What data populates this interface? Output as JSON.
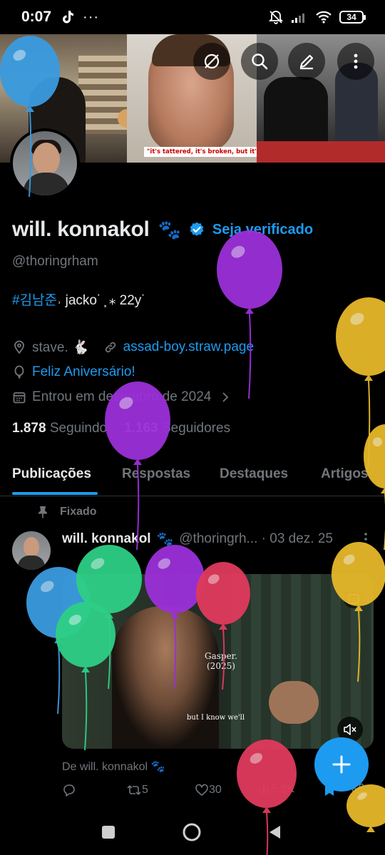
{
  "status_bar": {
    "time": "0:07",
    "battery": "34"
  },
  "header_actions": [
    "grok-icon",
    "search-icon",
    "edit-icon",
    "more-icon"
  ],
  "banner": {
    "caption": "\"it's tattered, it's broken, but it's mine.\""
  },
  "profile": {
    "name": "will. konnakol",
    "name_emoji": "🐾",
    "get_verified": "Seja verificado",
    "handle": "@thoringrham",
    "bio_tag": "#김남준",
    "bio_rest": "˒ jacko˙ ͙ ⁎ 22y˙",
    "location": "stave. 🐇",
    "website": "assad-boy.straw.page",
    "birthday": "Feliz Aniversário!",
    "joined": "Entrou em dezembro de 2024",
    "following_count": "1.878",
    "following_label": "Seguindo",
    "followers_count": "1.163",
    "followers_label": "Seguidores"
  },
  "tabs": [
    "Publicações",
    "Respostas",
    "Destaques",
    "Artigos"
  ],
  "post": {
    "pinned_label": "Fixado",
    "author": "will. konnakol",
    "author_emoji": "🐾",
    "handle_date": "@thoringrh... · 03 dez. 25",
    "media_label_title": "Gasper.",
    "media_label_year": "(2025)",
    "media_subtitle": "but I know we'll",
    "from_prefix": "De will. konnakol",
    "reposts": "5",
    "likes": "30",
    "views": "5,2K"
  },
  "colors": {
    "accent": "#1d9bf0",
    "background": "#000000",
    "text_primary": "#e7e9ea",
    "text_secondary": "#71767b"
  },
  "balloons": [
    {
      "color": "#3a9be0"
    },
    {
      "color": "#9b30d9"
    },
    {
      "color": "#e6b82a"
    },
    {
      "color": "#9b30d9"
    },
    {
      "color": "#e6b82a"
    },
    {
      "color": "#3a9be0"
    },
    {
      "color": "#2ecf86"
    },
    {
      "color": "#2ecf86"
    },
    {
      "color": "#9b30d9"
    },
    {
      "color": "#e03a5c"
    },
    {
      "color": "#e6b82a"
    },
    {
      "color": "#e03a5c"
    },
    {
      "color": "#e6b82a"
    }
  ]
}
